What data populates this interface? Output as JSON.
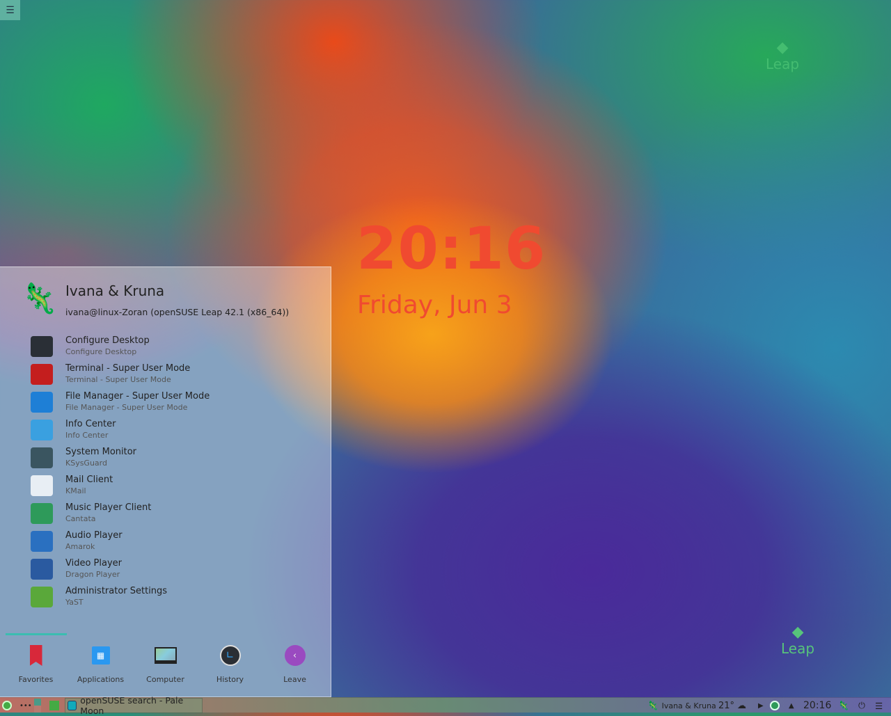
{
  "desktop": {
    "clock": "20:16",
    "date": "Friday, Jun 3",
    "logo_text": "Leap",
    "menu_icon": "hamburger-icon"
  },
  "menu": {
    "user_name": "Ivana & Kruna",
    "user_host": "ivana@linux-Zoran (openSUSE Leap 42.1 (x86_64))",
    "items": [
      {
        "title": "Configure Desktop",
        "subtitle": "Configure Desktop",
        "icon": "configure-icon",
        "color": "#2a2f36"
      },
      {
        "title": "Terminal - Super User Mode",
        "subtitle": "Terminal - Super User Mode",
        "icon": "terminal-icon",
        "color": "#c41e1e"
      },
      {
        "title": "File Manager - Super User Mode",
        "subtitle": "File Manager - Super User Mode",
        "icon": "folder-icon",
        "color": "#1e7fd6"
      },
      {
        "title": "Info Center",
        "subtitle": "Info Center",
        "icon": "info-icon",
        "color": "#3aa0e0"
      },
      {
        "title": "System Monitor",
        "subtitle": "KSysGuard",
        "icon": "system-monitor-icon",
        "color": "#3a5560"
      },
      {
        "title": "Mail Client",
        "subtitle": "KMail",
        "icon": "mail-icon",
        "color": "#e8eef4"
      },
      {
        "title": "Music Player Client",
        "subtitle": "Cantata",
        "icon": "cantata-icon",
        "color": "#2e9a5a"
      },
      {
        "title": "Audio Player",
        "subtitle": "Amarok",
        "icon": "amarok-icon",
        "color": "#2a70c0"
      },
      {
        "title": "Video Player",
        "subtitle": "Dragon Player",
        "icon": "dragon-icon",
        "color": "#2a5aa0"
      },
      {
        "title": "Administrator Settings",
        "subtitle": "YaST",
        "icon": "yast-icon",
        "color": "#5aa83a"
      }
    ],
    "tabs": [
      {
        "label": "Favorites",
        "icon": "bookmark-icon"
      },
      {
        "label": "Applications",
        "icon": "applications-icon"
      },
      {
        "label": "Computer",
        "icon": "computer-icon"
      },
      {
        "label": "History",
        "icon": "history-icon"
      },
      {
        "label": "Leave",
        "icon": "leave-icon"
      }
    ]
  },
  "taskbar": {
    "task_label": "openSUSE search - Pale Moon",
    "user_label": "Ivana & Kruna",
    "weather": "21°",
    "time": "20:16"
  }
}
